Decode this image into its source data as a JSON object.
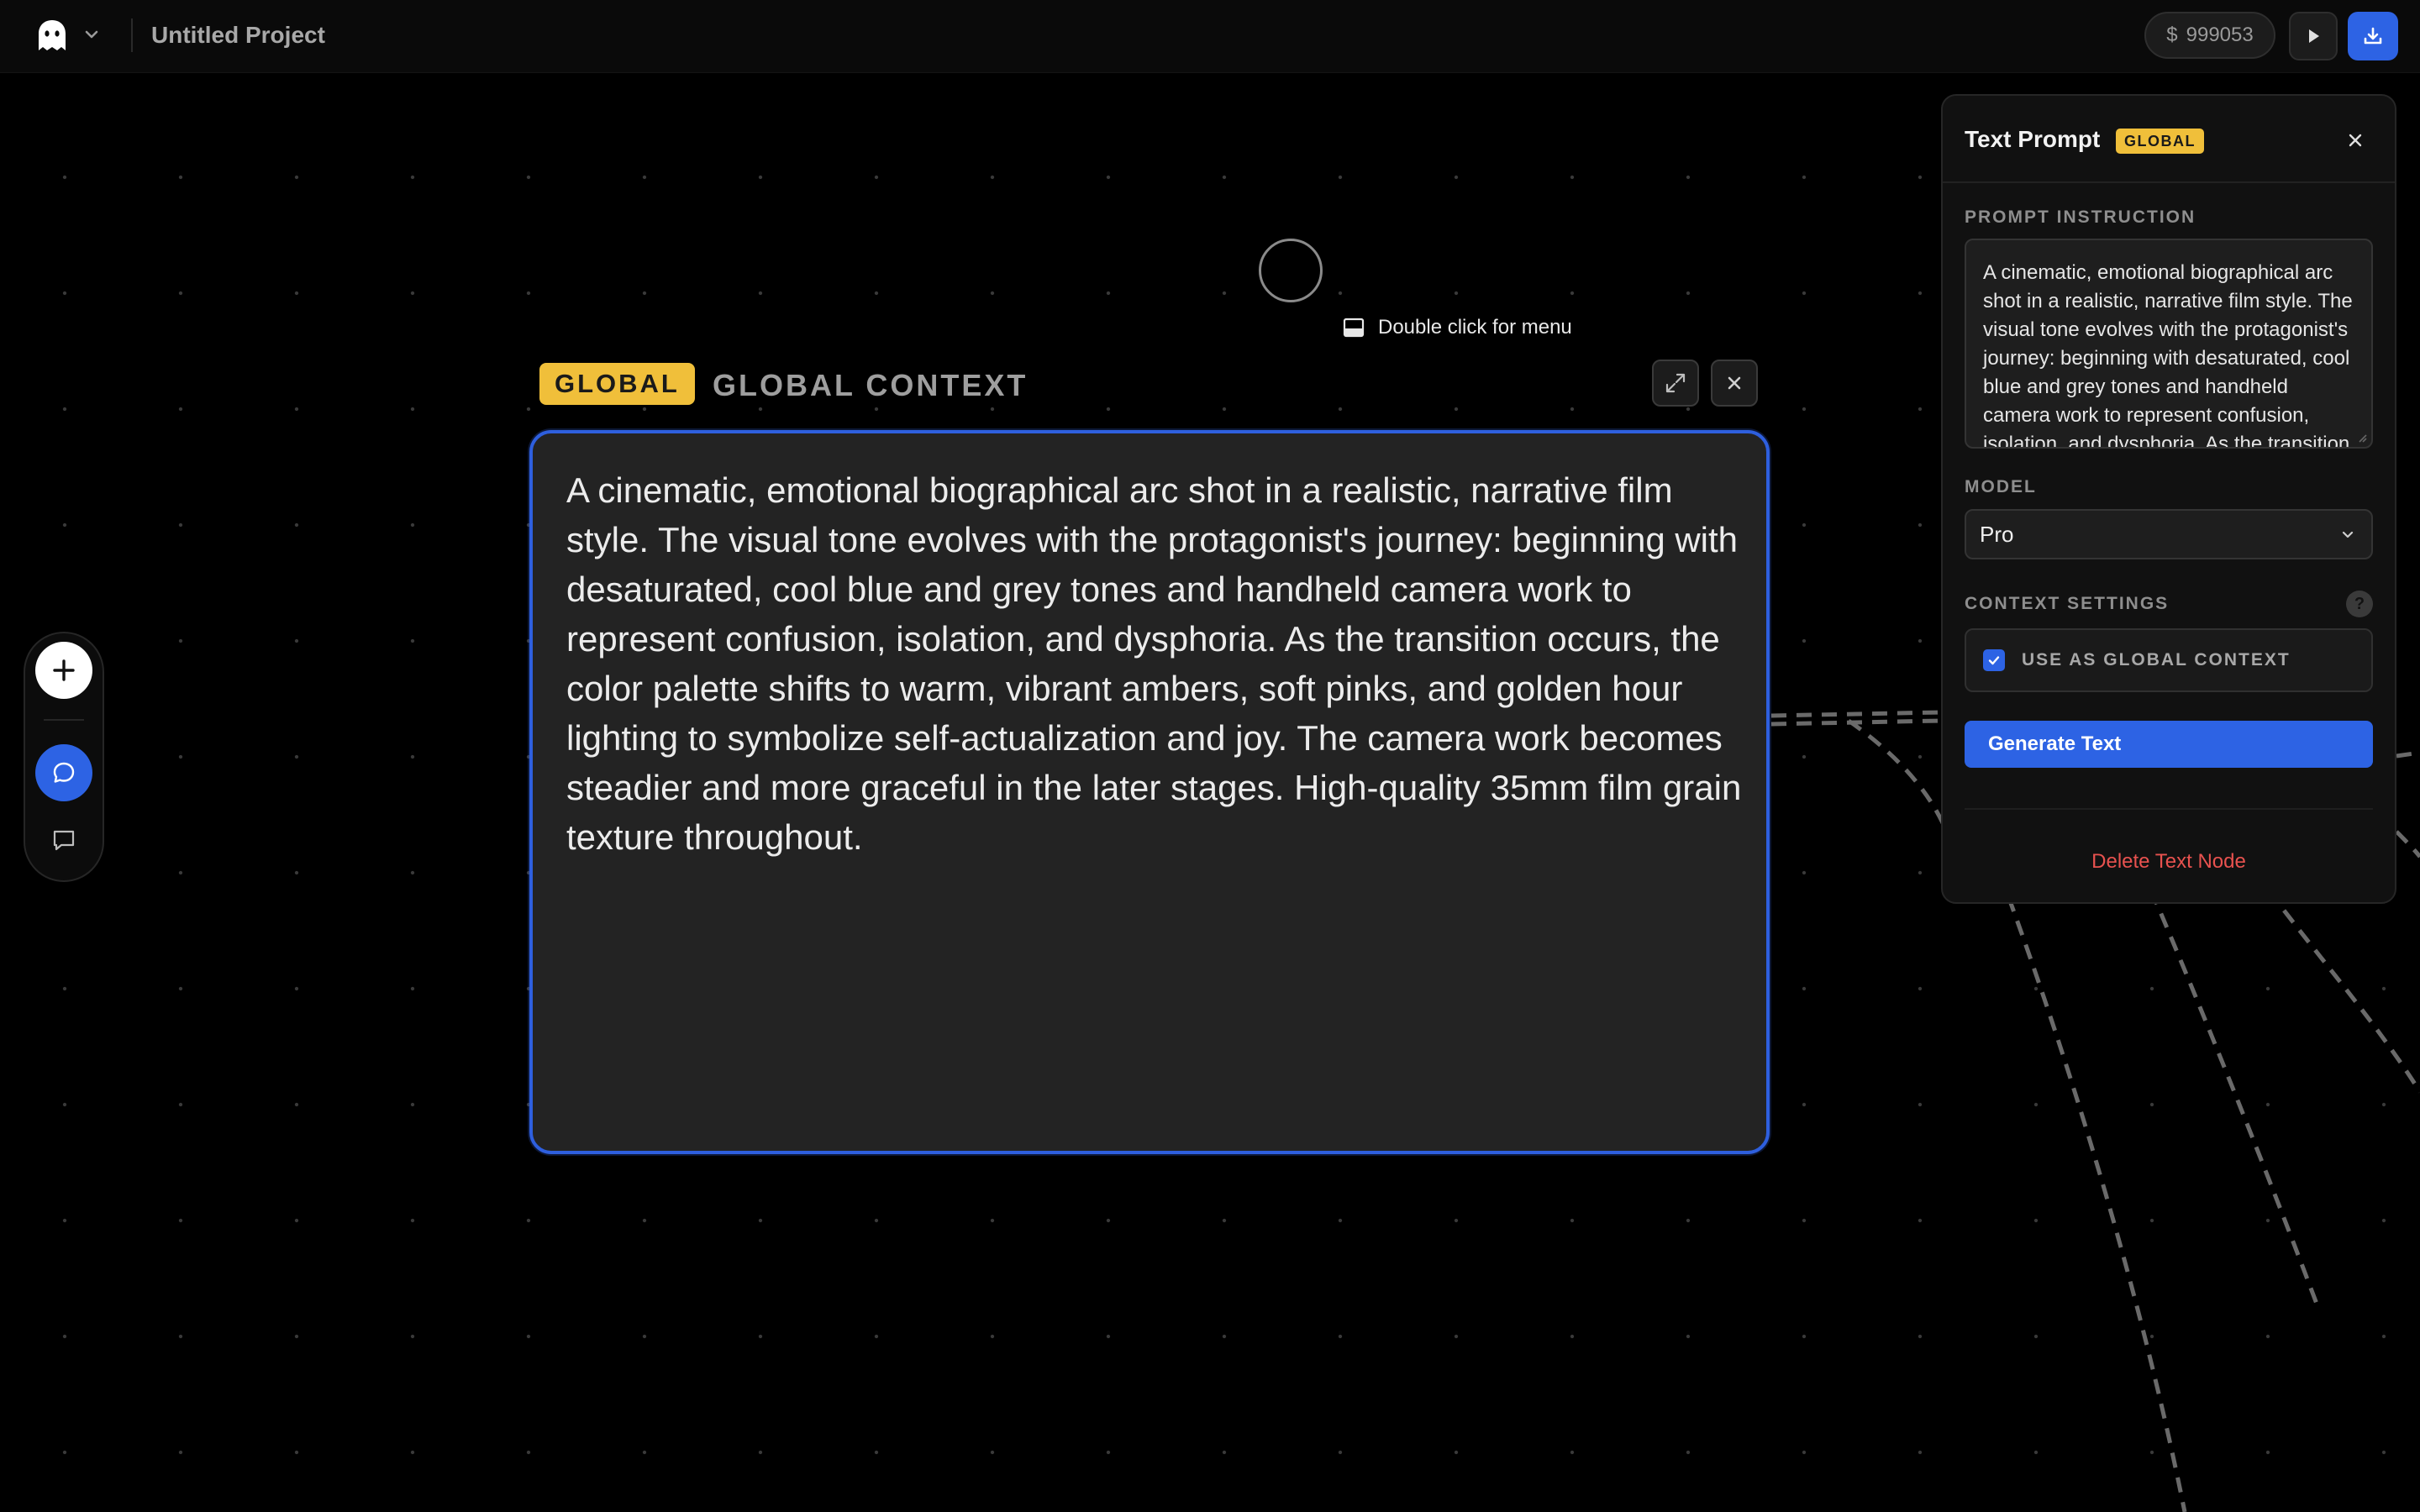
{
  "header": {
    "project_title": "Untitled Project",
    "credits": "999053",
    "logo_icon": "ghost-icon",
    "accent_color": "#2d63e4"
  },
  "hint": {
    "text": "Double click for menu"
  },
  "node": {
    "badge": "GLOBAL",
    "title": "GLOBAL CONTEXT",
    "text": "A cinematic, emotional biographical arc shot in a realistic, narrative film style. The visual tone evolves with the protagonist's journey: beginning with desaturated, cool blue and grey tones and handheld camera work to represent confusion, isolation, and dysphoria. As the transition occurs, the color palette shifts to warm, vibrant ambers, soft pinks, and golden hour lighting to symbolize self-actualization and joy. The camera work becomes steadier and more graceful in the later stages. High-quality 35mm film grain texture throughout.",
    "badge_color": "#f0bf3a",
    "border_color": "#2e5fde"
  },
  "panel": {
    "title": "Text Prompt",
    "badge": "GLOBAL",
    "prompt_label": "PROMPT INSTRUCTION",
    "prompt_text": "A cinematic, emotional biographical arc shot in a realistic, narrative film style. The visual tone evolves with the protagonist's journey: beginning with desaturated, cool blue and grey tones and handheld camera work to represent confusion, isolation, and dysphoria. As the transition occurs, the color palette shifts to warm, vibrant ambers, soft pinks, and golden hour lighting to symbolize self-actualization and joy. The camera work becomes steadier and more graceful in the later stages. High-quality 35mm film grain texture throughout.",
    "model_label": "MODEL",
    "model_value": "Pro",
    "context_label": "CONTEXT SETTINGS",
    "help_symbol": "?",
    "checkbox_label": "USE AS GLOBAL CONTEXT",
    "checkbox_checked": true,
    "generate_label": "Generate Text",
    "delete_label": "Delete Text Node",
    "delete_color": "#e8524f"
  }
}
